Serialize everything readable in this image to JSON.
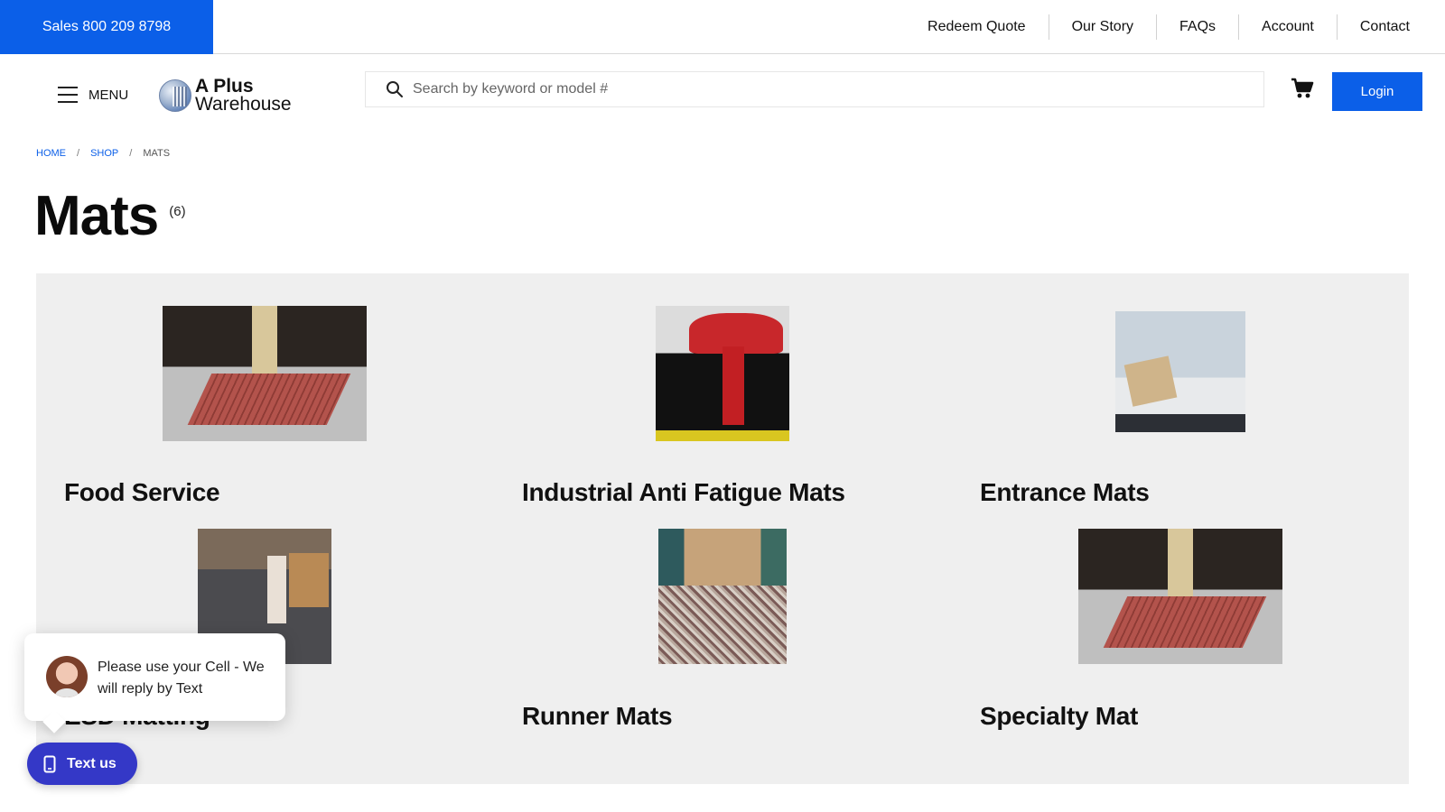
{
  "topbar": {
    "sales": "Sales 800 209 8798",
    "nav": [
      "Redeem Quote",
      "Our Story",
      "FAQs",
      "Account",
      "Contact"
    ]
  },
  "header": {
    "menu_label": "MENU",
    "logo_line1": "A Plus",
    "logo_line2": "Warehouse",
    "search_placeholder": "Search by keyword or model #",
    "login_label": "Login"
  },
  "breadcrumb": [
    "HOME",
    "SHOP",
    "MATS"
  ],
  "page": {
    "title": "Mats",
    "count": "(6)"
  },
  "categories": [
    {
      "name": "Food Service",
      "icon": "food-service-image"
    },
    {
      "name": "Industrial Anti Fatigue Mats",
      "icon": "industrial-mats-image"
    },
    {
      "name": "Entrance Mats",
      "icon": "entrance-mats-image"
    },
    {
      "name": "ESD Matting",
      "icon": "esd-matting-image"
    },
    {
      "name": "Runner Mats",
      "icon": "runner-mats-image"
    },
    {
      "name": "Specialty Mat",
      "icon": "specialty-mat-image"
    }
  ],
  "chat": {
    "message": "Please use your Cell - We will reply by Text",
    "button_label": "Text us"
  },
  "colors": {
    "brand_blue": "#0b5fe8",
    "chat_purple": "#3438c7",
    "grid_bg": "#efefef"
  }
}
